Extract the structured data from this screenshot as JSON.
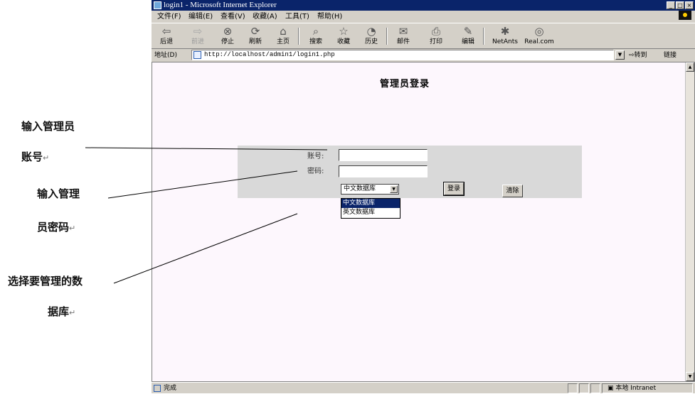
{
  "window": {
    "title": "login1 - Microsoft Internet Explorer",
    "controls": [
      "_",
      "□",
      "×"
    ]
  },
  "menu": [
    "文件(F)",
    "编辑(E)",
    "查看(V)",
    "收藏(A)",
    "工具(T)",
    "帮助(H)"
  ],
  "toolbar": [
    {
      "label": "后退",
      "icon": "back-arrow-icon",
      "glyph": "⇦",
      "enabled": true
    },
    {
      "label": "前进",
      "icon": "forward-arrow-icon",
      "glyph": "⇨",
      "enabled": false
    },
    {
      "label": "停止",
      "icon": "stop-icon",
      "glyph": "⊗",
      "enabled": true
    },
    {
      "label": "刷新",
      "icon": "refresh-icon",
      "glyph": "⟳",
      "enabled": true
    },
    {
      "label": "主页",
      "icon": "home-icon",
      "glyph": "⌂",
      "enabled": true
    },
    {
      "label": "搜索",
      "icon": "search-icon",
      "glyph": "⌕",
      "enabled": true
    },
    {
      "label": "收藏",
      "icon": "favorites-icon",
      "glyph": "☆",
      "enabled": true
    },
    {
      "label": "历史",
      "icon": "history-icon",
      "glyph": "◔",
      "enabled": true
    },
    {
      "label": "邮件",
      "icon": "mail-icon",
      "glyph": "✉",
      "enabled": true
    },
    {
      "label": "打印",
      "icon": "print-icon",
      "glyph": "⎙",
      "enabled": true
    },
    {
      "label": "编辑",
      "icon": "edit-icon",
      "glyph": "✎",
      "enabled": true
    },
    {
      "label": "NetAnts",
      "icon": "netants-icon",
      "glyph": "✱",
      "enabled": true
    },
    {
      "label": "Real.com",
      "icon": "real-icon",
      "glyph": "◎",
      "enabled": true
    }
  ],
  "address": {
    "label": "地址(D)",
    "url": "http://localhost/admin1/login1.php",
    "go": "转到",
    "links": "链接"
  },
  "page": {
    "title": "管理员登录",
    "account_label": "账号:",
    "password_label": "密码:",
    "account_value": "",
    "password_value": "",
    "db_selected": "中文数据库",
    "db_options": [
      "中文数据库",
      "英文数据库"
    ],
    "login_button": "登录",
    "reset_button": "清除"
  },
  "status": {
    "text": "完成",
    "zone": "本地 Intranet"
  },
  "annotations": {
    "account": {
      "line1": "输入管理员",
      "line2": "账号"
    },
    "password": {
      "line1": "输入管理",
      "line2": "员密码"
    },
    "database": {
      "line1": "选择要管理的数",
      "line2": "据库"
    },
    "return_mark": "↵"
  }
}
